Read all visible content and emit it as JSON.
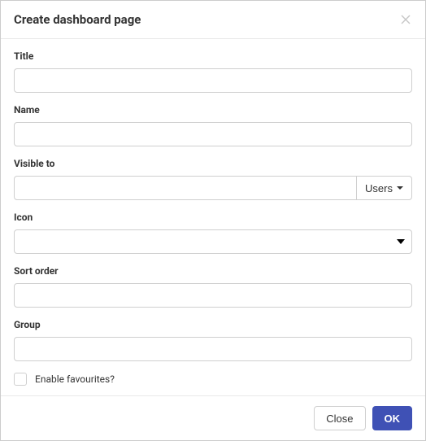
{
  "modal": {
    "title": "Create dashboard page"
  },
  "form": {
    "title_label": "Title",
    "title_value": "",
    "name_label": "Name",
    "name_value": "",
    "visible_to_label": "Visible to",
    "visible_to_value": "",
    "visible_to_button": "Users",
    "icon_label": "Icon",
    "icon_value": "",
    "sort_order_label": "Sort order",
    "sort_order_value": "",
    "group_label": "Group",
    "group_value": "",
    "enable_favourites_label": "Enable favourites?",
    "enable_favourites_checked": false
  },
  "footer": {
    "close_label": "Close",
    "ok_label": "OK"
  }
}
